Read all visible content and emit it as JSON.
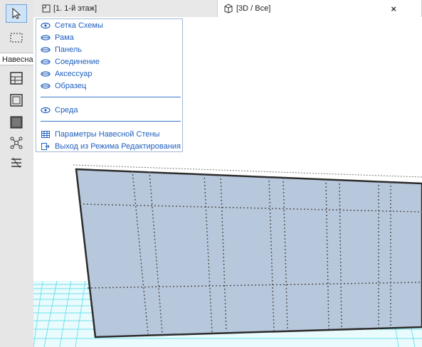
{
  "toolbox": {
    "section_label": "Навесна",
    "tools": [
      "arrow-icon",
      "marquee-icon",
      "curtain-wall-scheme-icon",
      "frame-icon",
      "panel-icon",
      "junction-icon",
      "accessory-icon"
    ]
  },
  "tabs": {
    "plan_label": "[1. 1-й этаж]",
    "view3d_label": "[3D / Все]",
    "close_glyph": "×"
  },
  "menu": {
    "items": [
      {
        "label": "Сетка Схемы",
        "icon": "eye-open-icon"
      },
      {
        "label": "Рама",
        "icon": "eye-closed-icon"
      },
      {
        "label": "Панель",
        "icon": "eye-closed-icon"
      },
      {
        "label": "Соединение",
        "icon": "eye-closed-icon"
      },
      {
        "label": "Аксессуар",
        "icon": "eye-closed-icon"
      },
      {
        "label": "Образец",
        "icon": "eye-closed-icon"
      }
    ],
    "environment": {
      "label": "Среда",
      "icon": "eye-open-icon"
    },
    "settings": {
      "label": "Параметры Навесной Стены",
      "icon": "grid-settings-icon"
    },
    "exit": {
      "label": "Выход из Режима Редактирования",
      "icon": "exit-icon"
    }
  },
  "colors": {
    "accent": "#1f5fbf",
    "wall_fill": "#b9c9dd",
    "ground_grid": "#3fd6e0"
  }
}
